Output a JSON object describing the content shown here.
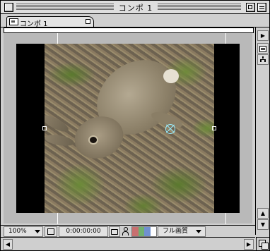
{
  "window": {
    "title": "コンポ 1"
  },
  "tab": {
    "label": "コンポ 1"
  },
  "side_buttons": {
    "menu_arrow": "▶",
    "scroll_up": "▲",
    "scroll_down": "▼"
  },
  "controls": {
    "zoom": "100%",
    "timecode": "0:00:00:00",
    "quality": "フル画質",
    "channel_colors": [
      "#c87070",
      "#70b070",
      "#7090d0",
      "#ffffff"
    ]
  },
  "hscroll": {
    "left": "◀",
    "right": "▶"
  }
}
